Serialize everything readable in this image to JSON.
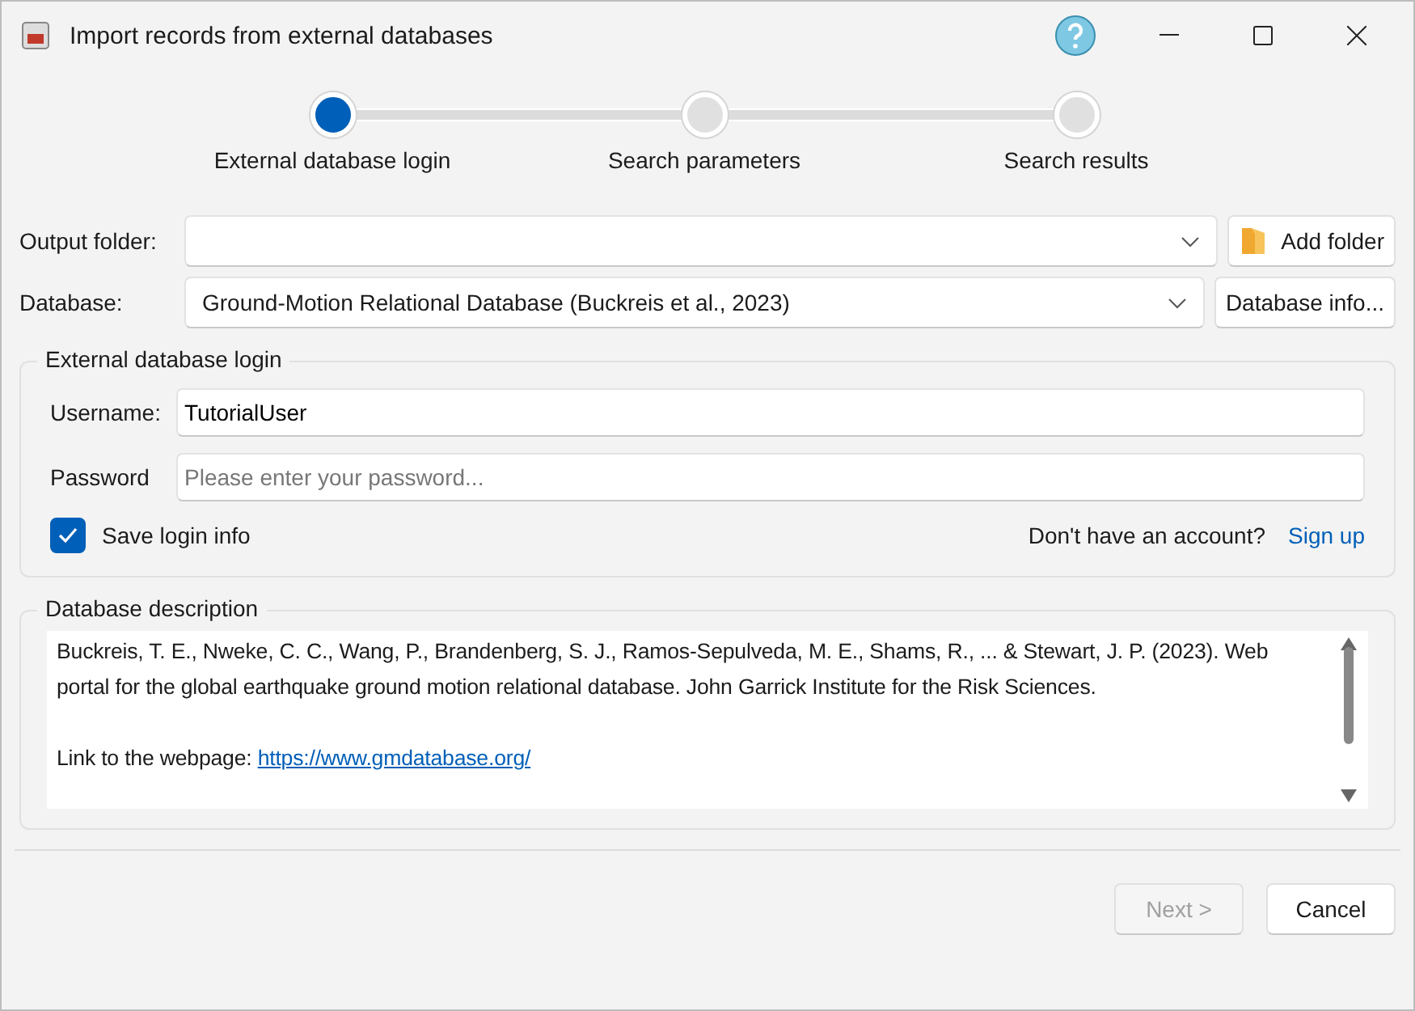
{
  "window": {
    "title": "Import records from external databases"
  },
  "steps": [
    {
      "label": "External database login",
      "selected": true
    },
    {
      "label": "Search parameters",
      "selected": false
    },
    {
      "label": "Search results",
      "selected": false
    }
  ],
  "output_folder": {
    "label": "Output folder:",
    "button": "Add folder"
  },
  "database": {
    "label": "Database:",
    "value": "Ground-Motion Relational Database (Buckreis et al., 2023)",
    "button": "Database info..."
  },
  "login": {
    "title": "External database login",
    "username_label": "Username:",
    "username": "TutorialUser",
    "password_label": "Password",
    "password_placeholder": "Please enter your password...",
    "save_label": "Save login info",
    "save_checked": true,
    "account_prompt": "Don't have an account?",
    "signup": "Sign up"
  },
  "description": {
    "title": "Database description",
    "citation": "Buckreis, T. E., Nweke, C. C., Wang, P., Brandenberg, S. J., Ramos-Sepulveda, M. E., Shams, R., ... & Stewart, J. P. (2023). Web portal for the global earthquake ground motion relational database. John Garrick Institute for the Risk Sciences.",
    "link_prefix": "Link to the webpage: ",
    "link": "https://www.gmdatabase.org/"
  },
  "buttons": [
    {
      "label": "Next >",
      "disabled": true
    },
    {
      "label": "Cancel",
      "disabled": false
    }
  ]
}
